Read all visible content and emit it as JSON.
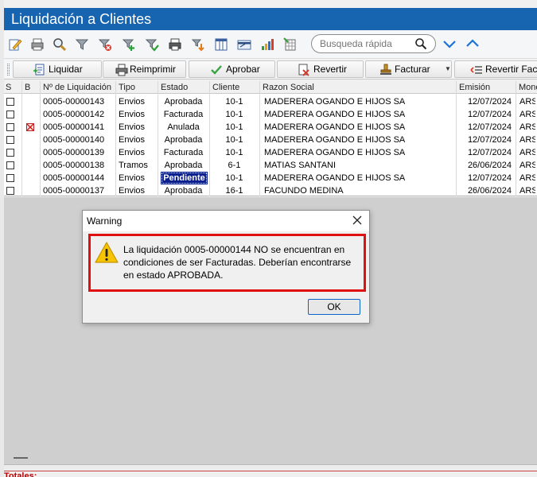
{
  "window": {
    "title": "Liquidación a Clientes"
  },
  "search": {
    "placeholder": "Busqueda rápida"
  },
  "toolbar_icons": [
    "edit-icon",
    "print-icon",
    "magnifier-icon",
    "filter-icon",
    "filter-clear-icon",
    "filter-add-icon",
    "filter-check-icon",
    "printer-small-icon",
    "download-icon",
    "columns-icon",
    "card-icon",
    "bar-chart-icon",
    "grid-export-icon"
  ],
  "actions": [
    {
      "key": "liquidar",
      "label": "Liquidar",
      "icon": "document-add-icon"
    },
    {
      "key": "reimprimir",
      "label": "Reimprimir",
      "icon": "printer-icon"
    },
    {
      "key": "aprobar",
      "label": "Aprobar",
      "icon": "checkmark-icon"
    },
    {
      "key": "revertir",
      "label": "Revertir",
      "icon": "document-x-icon"
    },
    {
      "key": "facturar",
      "label": "Facturar",
      "icon": "stamp-icon"
    },
    {
      "key": "revertir_fact",
      "label": "Revertir Factu",
      "icon": "list-back-icon"
    }
  ],
  "grid": {
    "columns": [
      "S",
      "B",
      "Nº de Liquidación",
      "Tipo",
      "Estado",
      "Cliente",
      "Razon Social",
      "Emisión",
      "Mone"
    ],
    "rows": [
      {
        "checked": false,
        "blocked": false,
        "numero": "0005-00000143",
        "tipo": "Envios",
        "estado": "Aprobada",
        "cliente": "10-1",
        "razon": "MADERERA OGANDO E HIJOS SA",
        "emision": "12/07/2024",
        "moneda": "ARS"
      },
      {
        "checked": false,
        "blocked": false,
        "numero": "0005-00000142",
        "tipo": "Envios",
        "estado": "Facturada",
        "cliente": "10-1",
        "razon": "MADERERA OGANDO E HIJOS SA",
        "emision": "12/07/2024",
        "moneda": "ARS"
      },
      {
        "checked": false,
        "blocked": true,
        "numero": "0005-00000141",
        "tipo": "Envios",
        "estado": "Anulada",
        "cliente": "10-1",
        "razon": "MADERERA OGANDO E HIJOS SA",
        "emision": "12/07/2024",
        "moneda": "ARS"
      },
      {
        "checked": false,
        "blocked": false,
        "numero": "0005-00000140",
        "tipo": "Envios",
        "estado": "Aprobada",
        "cliente": "10-1",
        "razon": "MADERERA OGANDO E HIJOS SA",
        "emision": "12/07/2024",
        "moneda": "ARS"
      },
      {
        "checked": false,
        "blocked": false,
        "numero": "0005-00000139",
        "tipo": "Envios",
        "estado": "Facturada",
        "cliente": "10-1",
        "razon": "MADERERA OGANDO E HIJOS SA",
        "emision": "12/07/2024",
        "moneda": "ARS"
      },
      {
        "checked": false,
        "blocked": false,
        "numero": "0005-00000138",
        "tipo": "Tramos",
        "estado": "Aprobada",
        "cliente": "6-1",
        "razon": "MATIAS SANTANI",
        "emision": "26/06/2024",
        "moneda": "ARS"
      },
      {
        "checked": false,
        "blocked": false,
        "numero": "0005-00000144",
        "tipo": "Envios",
        "estado": "Pendiente",
        "cliente": "10-1",
        "razon": "MADERERA OGANDO E HIJOS SA",
        "emision": "12/07/2024",
        "moneda": "ARS",
        "selected": true
      },
      {
        "checked": false,
        "blocked": false,
        "numero": "0005-00000137",
        "tipo": "Envios",
        "estado": "Aprobada",
        "cliente": "16-1",
        "razon": "FACUNDO MEDINA",
        "emision": "26/06/2024",
        "moneda": "ARS"
      }
    ]
  },
  "dialog": {
    "title": "Warning",
    "message": "La liquidación 0005-00000144 NO se encuentran en condiciones de ser Facturadas. Deberían encontrarse en estado APROBADA.",
    "ok_label": "OK",
    "icon": "warning-icon"
  },
  "footer": {
    "totales_label": "Totales:"
  },
  "colors": {
    "title_bar": "#1764b0",
    "selection": "#0b1f8e",
    "highlight_border": "#e01010",
    "chevron": "#1a73d9"
  }
}
